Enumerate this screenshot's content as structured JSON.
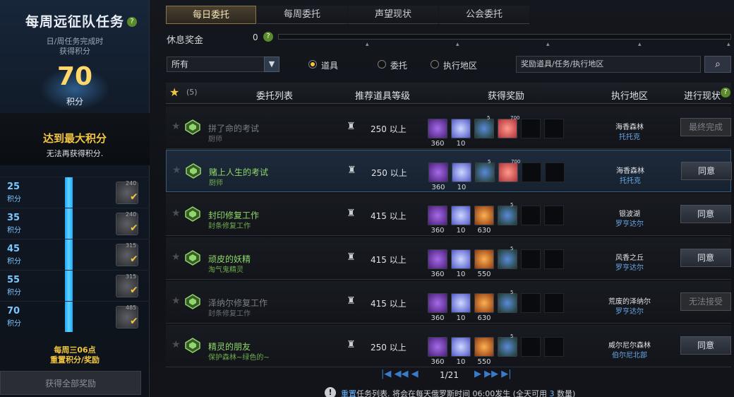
{
  "left": {
    "title": "每周远征队任务",
    "help": "?",
    "sub1": "日/周任务完成时",
    "sub2": "获得积分",
    "score": "70",
    "score_unit": "积分",
    "max_title": "达到最大积分",
    "max_sub": "无法再获得积分.",
    "milestones": [
      {
        "points": "25",
        "unit": "积分",
        "item_level": "240"
      },
      {
        "points": "35",
        "unit": "积分",
        "item_level": "240"
      },
      {
        "points": "45",
        "unit": "积分",
        "item_level": "315"
      },
      {
        "points": "55",
        "unit": "积分",
        "item_level": "315"
      },
      {
        "points": "70",
        "unit": "积分",
        "item_level": "485"
      }
    ],
    "reset1": "每周三06点",
    "reset2": "重置积分/奖励",
    "claim_all": "获得全部奖励"
  },
  "tabs": [
    "每日委托",
    "每周委托",
    "声望现状",
    "公会委托"
  ],
  "rest": {
    "label": "休息奖金",
    "value": "0",
    "help": "?"
  },
  "filter": {
    "select": "所有",
    "radios": [
      "道具",
      "委托",
      "执行地区"
    ],
    "search_placeholder": "奖励道具/任务/执行地区"
  },
  "header": {
    "count": "(5)",
    "cols": [
      "委托列表",
      "推荐道具等级",
      "获得奖励",
      "执行地区",
      "进行现状"
    ]
  },
  "rows": [
    {
      "name": "拼了命的考试",
      "sub": "厨师",
      "level": "250 以上",
      "dim": true,
      "rewards": [
        {
          "t": "purple",
          "c": "360"
        },
        {
          "t": "gem",
          "c": "10"
        },
        {
          "t": "potion",
          "c": "",
          "sup": "5"
        },
        {
          "t": "heart",
          "c": "",
          "sup": "700"
        }
      ],
      "loc": "海香森林",
      "loc2": "托托克",
      "status": "最终完成",
      "status_type": "off"
    },
    {
      "name": "赌上人生的考试",
      "sub": "厨师",
      "level": "250 以上",
      "dim": false,
      "rewards": [
        {
          "t": "purple",
          "c": "360"
        },
        {
          "t": "gem",
          "c": "10"
        },
        {
          "t": "potion",
          "c": "",
          "sup": "5"
        },
        {
          "t": "heart",
          "c": "",
          "sup": "700"
        }
      ],
      "loc": "海香森林",
      "loc2": "托托克",
      "status": "同意",
      "status_type": "ok"
    },
    {
      "name": "封印修复工作",
      "sub": "封条修复工作",
      "level": "415 以上",
      "dim": false,
      "rewards": [
        {
          "t": "purple",
          "c": "360"
        },
        {
          "t": "gem",
          "c": "10"
        },
        {
          "t": "orange",
          "c": "630"
        },
        {
          "t": "potion",
          "c": "",
          "sup": "5"
        }
      ],
      "loc": "银波湖",
      "loc2": "罗亨达尔",
      "status": "同意",
      "status_type": "ok"
    },
    {
      "name": "顽皮的妖精",
      "sub": "淘气鬼精灵",
      "level": "415 以上",
      "dim": false,
      "rewards": [
        {
          "t": "purple",
          "c": "360"
        },
        {
          "t": "gem",
          "c": "10"
        },
        {
          "t": "orange",
          "c": "550"
        },
        {
          "t": "potion",
          "c": "",
          "sup": "5"
        }
      ],
      "loc": "风香之丘",
      "loc2": "罗亨达尔",
      "status": "同意",
      "status_type": "ok"
    },
    {
      "name": "泽纳尔修复工作",
      "sub": "封条修复工作",
      "level": "415 以上",
      "dim": true,
      "rewards": [
        {
          "t": "purple",
          "c": "360"
        },
        {
          "t": "gem",
          "c": "10"
        },
        {
          "t": "orange",
          "c": "630"
        },
        {
          "t": "potion",
          "c": "",
          "sup": "5"
        }
      ],
      "loc": "荒废的泽纳尔",
      "loc2": "罗亨达尔",
      "status": "无法接受",
      "status_type": "off"
    },
    {
      "name": "精灵的朋友",
      "sub": "保护森林~绿色的~",
      "level": "250 以上",
      "dim": false,
      "rewards": [
        {
          "t": "purple",
          "c": "360"
        },
        {
          "t": "gem",
          "c": "10"
        },
        {
          "t": "orange",
          "c": "550"
        },
        {
          "t": "potion",
          "c": "",
          "sup": "5"
        }
      ],
      "loc": "威尔尼尔森林",
      "loc2": "伯尔尼北部",
      "status": "同意",
      "status_type": "ok"
    }
  ],
  "pager": {
    "text": "1/21"
  },
  "notice": {
    "part1": "重置",
    "part2": "任务列表. 将会在每天俄罗斯时间 06:00发生 (全天可用 ",
    "part3": "3",
    "part4": " 数量)"
  }
}
